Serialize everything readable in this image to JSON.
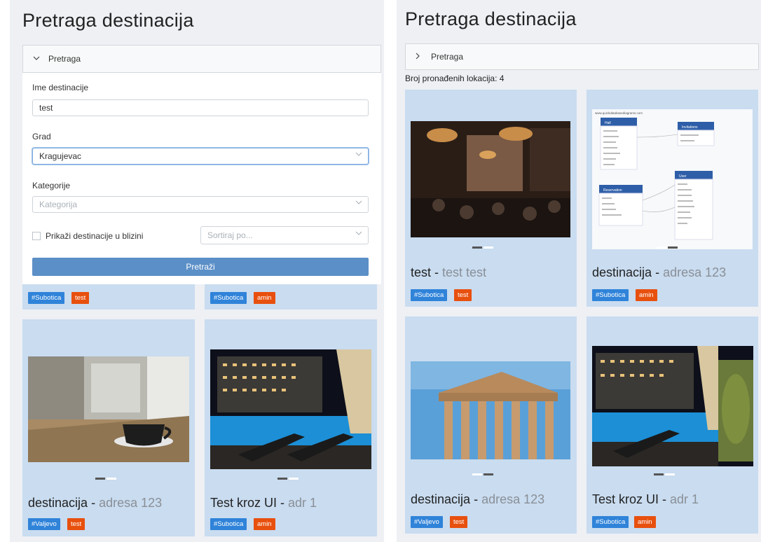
{
  "left": {
    "page_title": "Pretraga destinacija",
    "accordion_label": "Pretraga",
    "form": {
      "name_label": "Ime destinacije",
      "name_value": "test",
      "city_label": "Grad",
      "city_value": "Kragujevac",
      "category_label": "Kategorije",
      "category_placeholder": "Kategorija",
      "nearby_label": "Prikaži destinacije u blizini",
      "sort_placeholder": "Sortiraj po...",
      "search_button": "Pretraži"
    },
    "cards_top": [
      {
        "city_tag": "#Subotica",
        "category_tag": "test"
      },
      {
        "city_tag": "#Subotica",
        "category_tag": "amin"
      }
    ],
    "cards": [
      {
        "name": "destinacija",
        "separator": " - ",
        "address": "adresa 123",
        "city_tag": "#Valjevo",
        "category_tag": "test"
      },
      {
        "name": "Test kroz UI",
        "separator": " - ",
        "address": "adr 1",
        "city_tag": "#Subotica",
        "category_tag": "amin"
      }
    ]
  },
  "right": {
    "page_title": "Pretraga destinacija",
    "accordion_label": "Pretraga",
    "result_count": "Broj pronađenih lokacija: 4",
    "diagram_url": "www.quickdatabasediagrams.com",
    "diagram_tables": [
      "Hall",
      "Invitations",
      "Reservation",
      "User"
    ],
    "cards": [
      {
        "name": "test",
        "separator": " - ",
        "address": "test test",
        "city_tag": "#Subotica",
        "category_tag": "test"
      },
      {
        "name": "destinacija",
        "separator": " - ",
        "address": "adresa 123",
        "city_tag": "#Subotica",
        "category_tag": "amin"
      },
      {
        "name": "destinacija",
        "separator": " - ",
        "address": "adresa 123",
        "city_tag": "#Valjevo",
        "category_tag": "test"
      },
      {
        "name": "Test kroz UI",
        "separator": " - ",
        "address": "adr 1",
        "city_tag": "#Subotica",
        "category_tag": "amin"
      }
    ]
  },
  "colors": {
    "card_bg": "#c9dcf0",
    "city_tag": "#2f83d9",
    "category_tag": "#e8500e",
    "search_button": "#5b8fc7",
    "panel_bg": "#eef0f4"
  },
  "icons": {
    "accordion_open": "chevron-down-icon",
    "accordion_closed": "chevron-right-icon",
    "select_arrow": "chevron-down-icon"
  }
}
